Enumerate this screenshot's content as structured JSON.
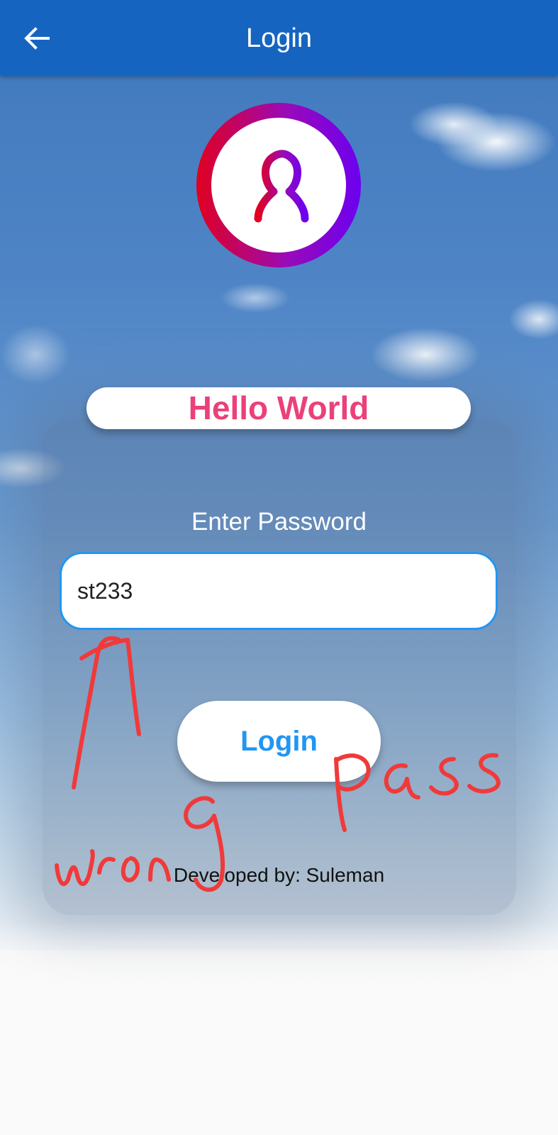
{
  "app_bar": {
    "title": "Login",
    "back_icon": "arrow-left-icon",
    "color": "#1565c0"
  },
  "avatar": {
    "icon": "user-silhouette-icon",
    "ring_colors": [
      "#e0001f",
      "#6c00f0"
    ]
  },
  "banner": {
    "text": "Hello World",
    "color": "#ec407a"
  },
  "password": {
    "label": "Enter Password",
    "value": "st233",
    "focus_color": "#2196f3"
  },
  "login_button": {
    "label": "Login",
    "color": "#2196f3"
  },
  "footer": {
    "text": "Developed by: Suleman"
  },
  "annotation": {
    "text": "wrong Pass",
    "color": "#f03a3a"
  }
}
